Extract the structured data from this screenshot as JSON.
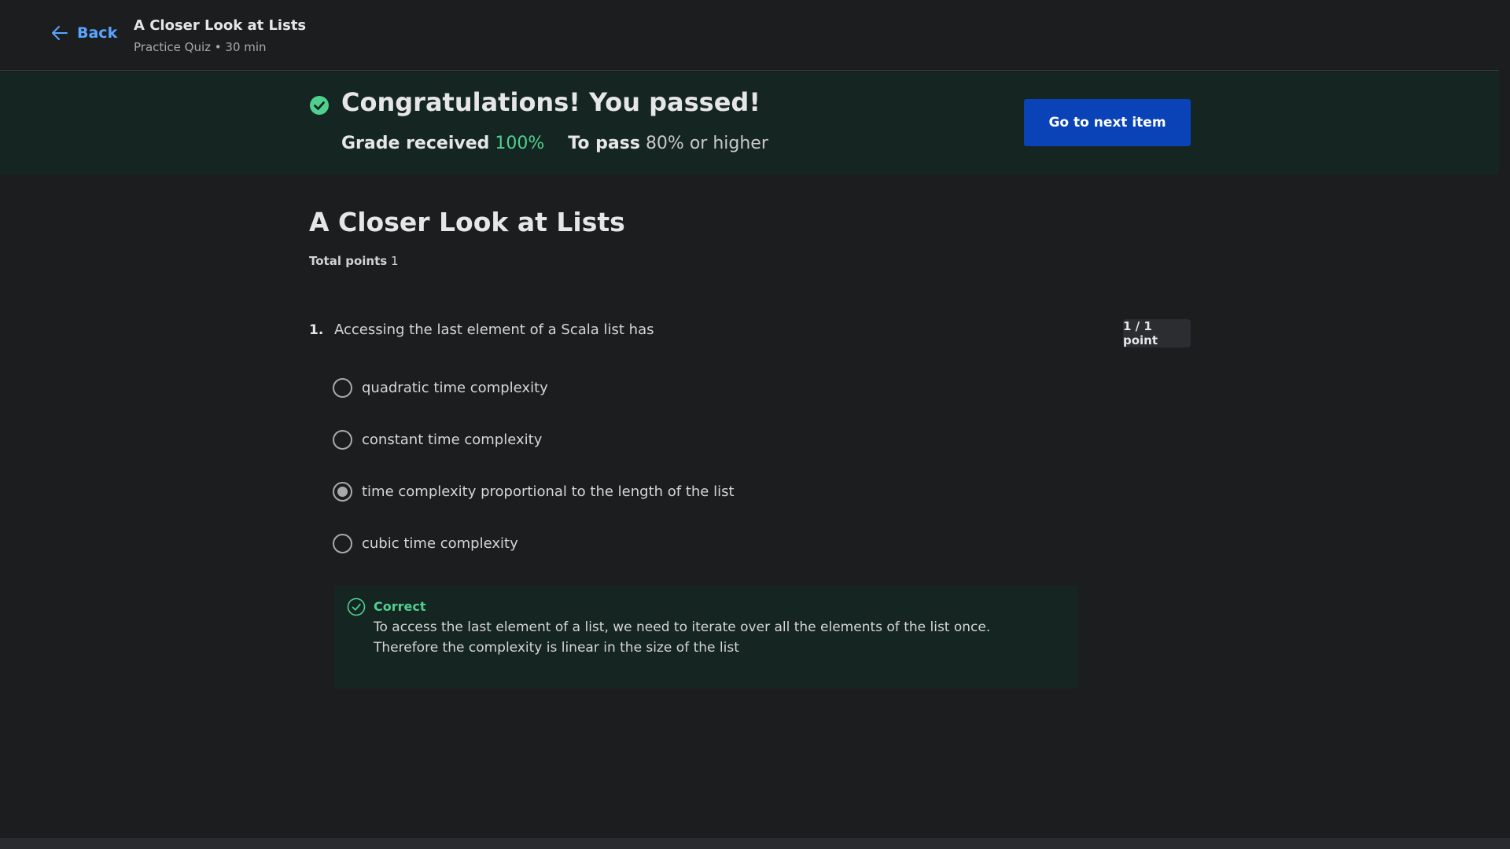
{
  "header": {
    "back_label": "Back",
    "item_title": "A Closer Look at Lists",
    "item_subtitle": "Practice Quiz • 30 min"
  },
  "banner": {
    "title": "Congratulations! You passed!",
    "grade_label": "Grade received",
    "grade_value": "100%",
    "pass_label": "To pass",
    "pass_value": "80% or higher",
    "next_button": "Go to next item",
    "accent_color": "#4fd08f",
    "button_color": "#0a43b8"
  },
  "quiz": {
    "heading": "A Closer Look at Lists",
    "total_points_label": "Total points",
    "total_points_value": "1",
    "question": {
      "number": "1.",
      "text": "Accessing the last element of a Scala list has",
      "points": "1 / 1 point",
      "options": [
        {
          "label": "quadratic time complexity",
          "selected": false
        },
        {
          "label": "constant time complexity",
          "selected": false
        },
        {
          "label": "time complexity proportional to the length of the list",
          "selected": true
        },
        {
          "label": "cubic time complexity",
          "selected": false
        }
      ],
      "feedback": {
        "status": "Correct",
        "text": "To access the last element of a list, we need to iterate over all the elements of the list once. Therefore the complexity is linear in the size of the list"
      }
    }
  }
}
